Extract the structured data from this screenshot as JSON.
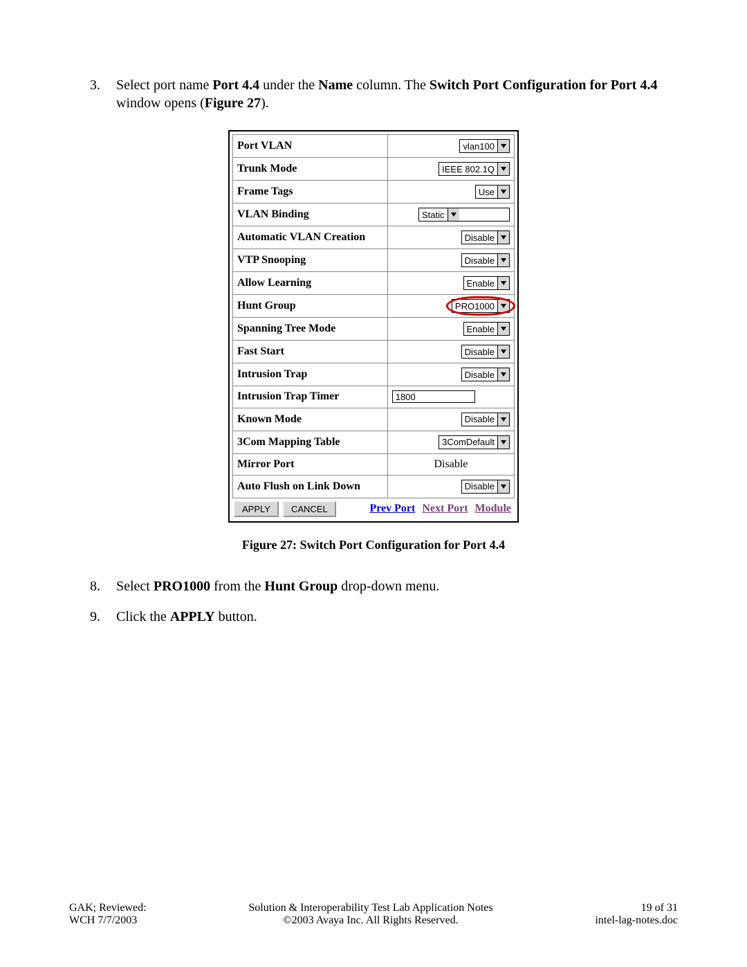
{
  "step3": {
    "num": "3.",
    "text_a": "Select port name ",
    "bold_a": "Port 4.4",
    "text_b": " under the ",
    "bold_b": "Name",
    "text_c": " column.  The ",
    "bold_c": "Switch Port Configuration for Port 4.4",
    "text_d": " window opens (",
    "bold_d": "Figure 27",
    "text_e": ")."
  },
  "config": {
    "rows": [
      {
        "label": "Port VLAN",
        "type": "dd",
        "value": "vlan100",
        "name": "port-vlan-select"
      },
      {
        "label": "Trunk Mode",
        "type": "dd",
        "value": "IEEE 802.1Q",
        "name": "trunk-mode-select"
      },
      {
        "label": "Frame Tags",
        "type": "dd",
        "value": "Use",
        "name": "frame-tags-select"
      },
      {
        "label": "VLAN Binding",
        "type": "dd",
        "value": "Static",
        "name": "vlan-binding-select",
        "wide": true
      },
      {
        "label": "Automatic VLAN Creation",
        "type": "dd",
        "value": "Disable",
        "name": "auto-vlan-creation-select"
      },
      {
        "label": "VTP Snooping",
        "type": "dd",
        "value": "Disable",
        "name": "vtp-snooping-select"
      },
      {
        "label": "Allow Learning",
        "type": "dd",
        "value": "Enable",
        "name": "allow-learning-select"
      },
      {
        "label": "Hunt Group",
        "type": "dd",
        "value": "PRO1000",
        "name": "hunt-group-select",
        "highlight": true
      },
      {
        "label": "Spanning Tree Mode",
        "type": "dd",
        "value": "Enable",
        "name": "spanning-tree-mode-select"
      },
      {
        "label": "Fast Start",
        "type": "dd",
        "value": "Disable",
        "name": "fast-start-select"
      },
      {
        "label": "Intrusion Trap",
        "type": "dd",
        "value": "Disable",
        "name": "intrusion-trap-select"
      },
      {
        "label": "Intrusion Trap Timer",
        "type": "text",
        "value": "1800",
        "name": "intrusion-trap-timer-input"
      },
      {
        "label": "Known Mode",
        "type": "dd",
        "value": "Disable",
        "name": "known-mode-select"
      },
      {
        "label": "3Com Mapping Table",
        "type": "dd",
        "value": "3ComDefault",
        "name": "three-com-mapping-select"
      },
      {
        "label": "Mirror Port",
        "type": "static",
        "value": "Disable",
        "name": "mirror-port-value"
      },
      {
        "label": "Auto Flush on Link Down",
        "type": "dd",
        "value": "Disable",
        "name": "auto-flush-select"
      }
    ],
    "buttons": {
      "apply": "APPLY",
      "cancel": "CANCEL"
    },
    "nav": {
      "prev": "Prev Port",
      "next": "Next Port",
      "module": "Module",
      "prev_color": "#0000cc",
      "next_color": "#7a3f7a",
      "module_color": "#7a3f7a"
    }
  },
  "figcaption": "Figure 27: Switch Port Configuration for Port 4.4",
  "step8": {
    "num": "8.",
    "text_a": "Select ",
    "bold_a": "PRO1000",
    "text_b": " from the ",
    "bold_b": "Hunt Group",
    "text_c": " drop-down menu."
  },
  "step9": {
    "num": "9.",
    "text_a": "Click the ",
    "bold_a": "APPLY",
    "text_b": " button."
  },
  "footer": {
    "left1": "GAK; Reviewed:",
    "left2": "WCH 7/7/2003",
    "center1": "Solution & Interoperability Test Lab Application Notes",
    "center2": "©2003 Avaya Inc. All Rights Reserved.",
    "right1": "19 of 31",
    "right2": "intel-lag-notes.doc"
  }
}
